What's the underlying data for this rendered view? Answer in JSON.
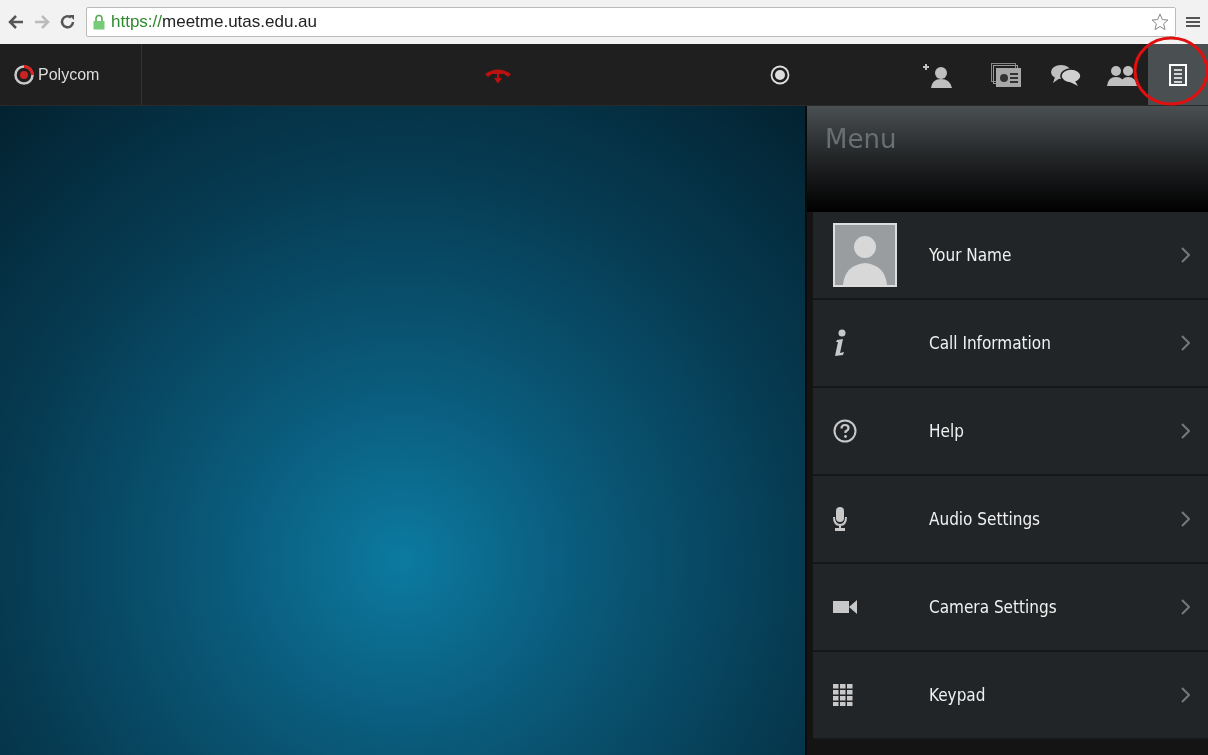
{
  "browser": {
    "url_scheme": "https://",
    "url_host": "meetme.utas.edu.au"
  },
  "toolbar": {
    "logo": "Polycom",
    "buttons": [
      {
        "kind": "add-person",
        "selected": false
      },
      {
        "kind": "content",
        "selected": false
      },
      {
        "kind": "chat",
        "selected": false
      },
      {
        "kind": "people",
        "selected": false
      },
      {
        "kind": "menu",
        "selected": true,
        "circled": true
      }
    ]
  },
  "menu": {
    "title": "Menu",
    "items": [
      {
        "kind": "avatar",
        "label": "Your Name"
      },
      {
        "kind": "info",
        "label": "Call Information"
      },
      {
        "kind": "help",
        "label": "Help"
      },
      {
        "kind": "mic",
        "label": "Audio Settings"
      },
      {
        "kind": "camera",
        "label": "Camera Settings"
      },
      {
        "kind": "keypad",
        "label": "Keypad"
      }
    ]
  }
}
